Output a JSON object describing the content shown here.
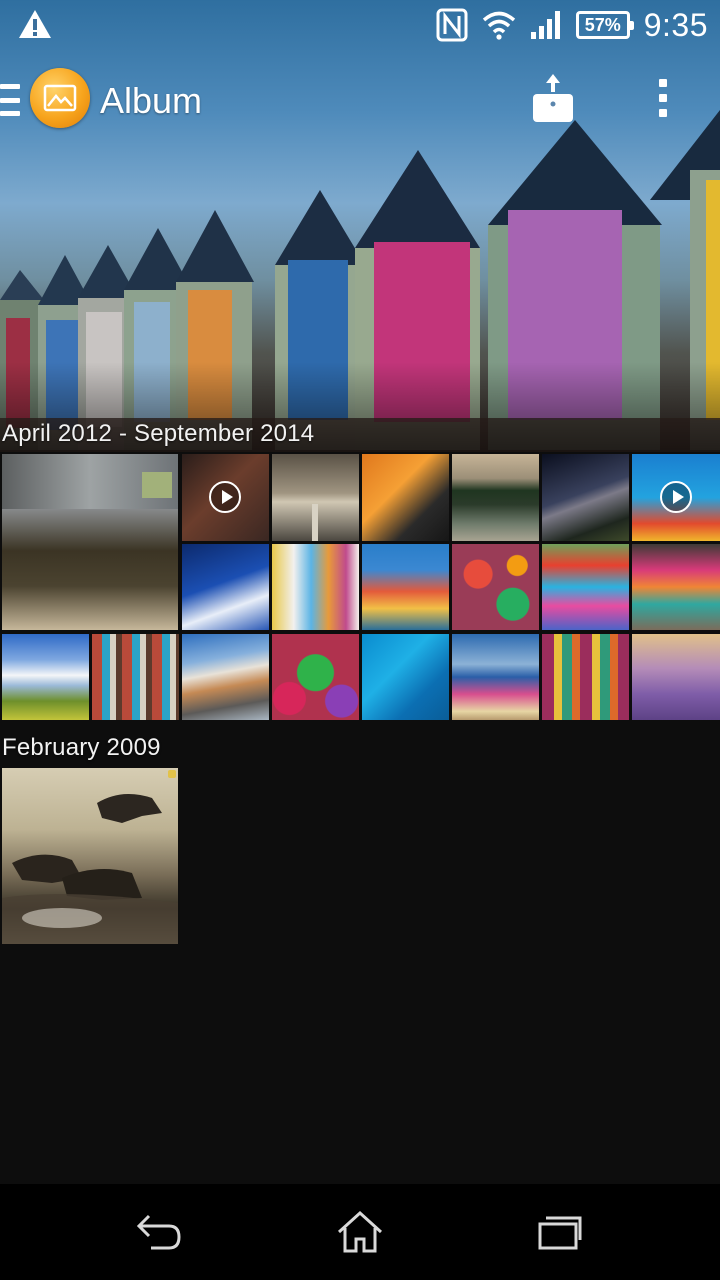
{
  "status_bar": {
    "time": "9:35",
    "battery": "57%",
    "icons": [
      "warning-icon",
      "nfc-icon",
      "wifi-icon",
      "signal-icon",
      "battery-icon"
    ]
  },
  "action_bar": {
    "title": "Album",
    "icons": [
      "menu-icon",
      "album-app-icon",
      "upload-icon",
      "overflow-menu-icon"
    ]
  },
  "sections": [
    {
      "title": "April 2012 - September 2014",
      "photos": [
        {
          "subject": "shop window",
          "video": false
        },
        {
          "subject": "brownstone street",
          "video": true
        },
        {
          "subject": "desert road",
          "video": false
        },
        {
          "subject": "modern building at dusk",
          "video": false
        },
        {
          "subject": "forest lake reflection",
          "video": false
        },
        {
          "subject": "milky way",
          "video": false
        },
        {
          "subject": "coral reef",
          "video": true
        },
        {
          "subject": "snowy village",
          "video": false
        },
        {
          "subject": "colorful houses",
          "video": false
        },
        {
          "subject": "harbor houses",
          "video": false
        },
        {
          "subject": "glass balls",
          "video": false
        },
        {
          "subject": "colorful boats",
          "video": false
        },
        {
          "subject": "yarn skeins",
          "video": false
        },
        {
          "subject": "clouds over field",
          "video": false
        },
        {
          "subject": "building facade",
          "video": false
        },
        {
          "subject": "mountain peaks",
          "video": false
        },
        {
          "subject": "fabric roses",
          "video": false
        },
        {
          "subject": "lagoon aerial",
          "video": false
        },
        {
          "subject": "beach huts",
          "video": false
        },
        {
          "subject": "textiles market",
          "video": false
        },
        {
          "subject": "lavender forest",
          "video": false
        }
      ]
    },
    {
      "title": "February 2009",
      "photos": [
        {
          "subject": "wildebeest river crossing",
          "video": false
        }
      ]
    }
  ],
  "nav_bar": {
    "icons": [
      "back-icon",
      "home-icon",
      "recent-apps-icon"
    ]
  }
}
